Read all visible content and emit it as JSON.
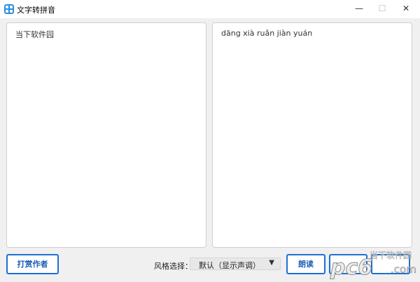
{
  "window": {
    "title": "文字转拼音",
    "minimize": "—",
    "maximize": "☐",
    "close": "✕"
  },
  "input_panel": {
    "text": "当下软件园"
  },
  "output_panel": {
    "text": "dāng xià ruǎn jiàn yuán"
  },
  "footer": {
    "reward_button": "打赏作者",
    "style_label": "风格选择：",
    "style_select": "默认（显示声调）",
    "read_button": "朗读"
  },
  "watermark": {
    "text": "当下软件园",
    "brand": "pc6",
    "site": ".com"
  },
  "colors": {
    "accent": "#1e6fd3",
    "icon": "#2a8de0"
  }
}
